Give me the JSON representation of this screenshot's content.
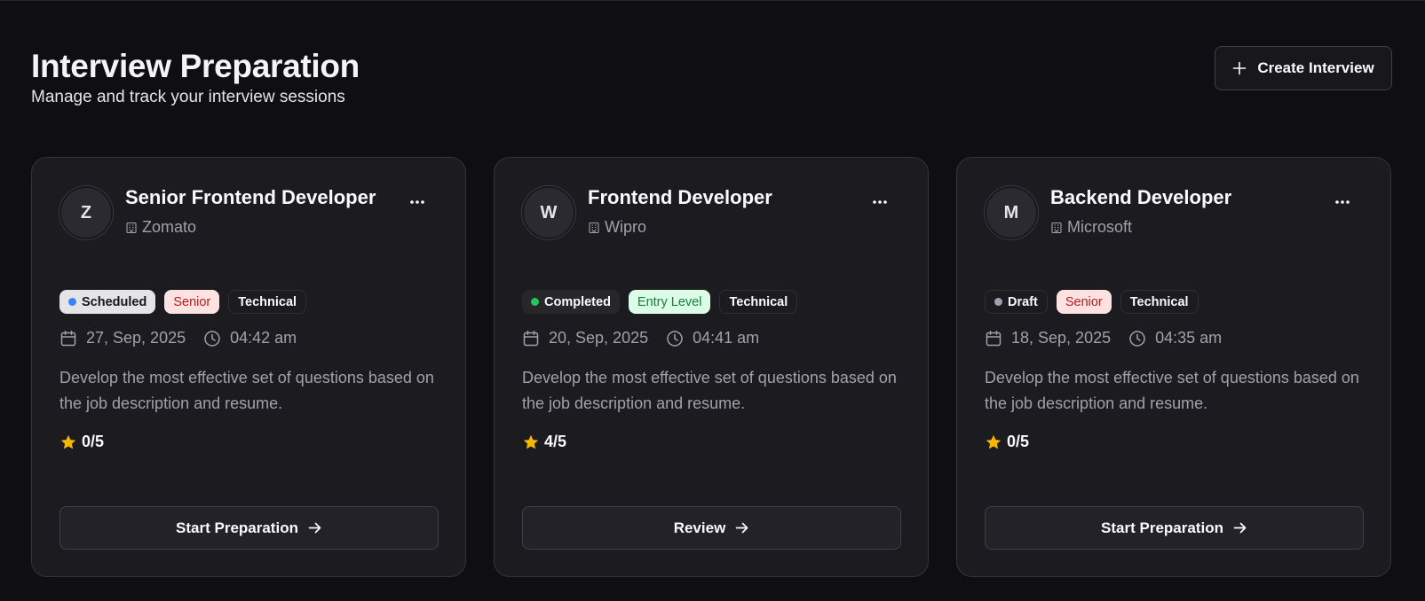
{
  "header": {
    "title": "Interview Preparation",
    "subtitle": "Manage and track your interview sessions",
    "create_button_label": "Create Interview"
  },
  "cards": [
    {
      "avatar_letter": "Z",
      "title": "Senior Frontend Developer",
      "company": "Zomato",
      "status": "Scheduled",
      "status_color": "#3b82f6",
      "level": "Senior",
      "type": "Technical",
      "date": "27, Sep, 2025",
      "time": "04:42 am",
      "description": "Develop the most effective set of questions based on the job description and resume.",
      "rating": "0/5",
      "action_label": "Start Preparation"
    },
    {
      "avatar_letter": "W",
      "title": "Frontend Developer",
      "company": "Wipro",
      "status": "Completed",
      "status_color": "#22c55e",
      "level": "Entry Level",
      "type": "Technical",
      "date": "20, Sep, 2025",
      "time": "04:41 am",
      "description": "Develop the most effective set of questions based on the job description and resume.",
      "rating": "4/5",
      "action_label": "Review"
    },
    {
      "avatar_letter": "M",
      "title": "Backend Developer",
      "company": "Microsoft",
      "status": "Draft",
      "status_color": "#9ca3af",
      "level": "Senior",
      "type": "Technical",
      "date": "18, Sep, 2025",
      "time": "04:35 am",
      "description": "Develop the most effective set of questions based on the job description and resume.",
      "rating": "0/5",
      "action_label": "Start Preparation"
    }
  ],
  "icons": {
    "create": "plus-icon",
    "company": "building-icon",
    "menu": "more-horizontal-icon",
    "date": "calendar-icon",
    "time": "clock-icon",
    "rating": "star-icon",
    "action": "arrow-right-icon"
  },
  "colors": {
    "background": "#0f0f13",
    "card": "#1b1b20",
    "star": "#f5b800",
    "senior_badge_bg": "#fde2e2",
    "senior_badge_text": "#b91c1c",
    "entry_badge_bg": "#dcfce7",
    "entry_badge_text": "#15803d"
  }
}
